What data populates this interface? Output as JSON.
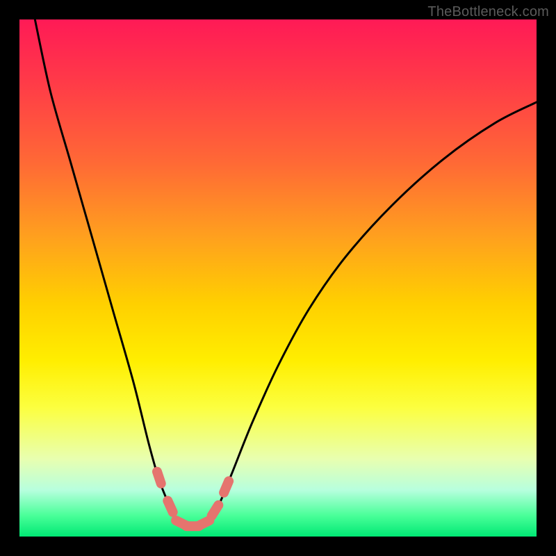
{
  "watermark": "TheBottleneck.com",
  "chart_data": {
    "type": "line",
    "title": "",
    "xlabel": "",
    "ylabel": "",
    "xlim": [
      0,
      100
    ],
    "ylim": [
      0,
      100
    ],
    "grid": false,
    "legend": false,
    "series": [
      {
        "name": "bottleneck-curve",
        "x": [
          3,
          6,
          10,
          14,
          18,
          22,
          25,
          27,
          29,
          30.5,
          32.5,
          34.5,
          36.5,
          38.5,
          41,
          45,
          50,
          56,
          63,
          72,
          82,
          92,
          100
        ],
        "values": [
          100,
          86,
          72,
          58,
          44,
          30,
          18,
          11,
          6,
          3,
          2,
          2,
          3,
          6,
          12,
          22,
          33,
          44,
          54,
          64,
          73,
          80,
          84
        ]
      }
    ],
    "annotations": [
      {
        "name": "highlight-zone",
        "x_range": [
          27,
          40
        ],
        "color": "#e5746e"
      }
    ]
  }
}
